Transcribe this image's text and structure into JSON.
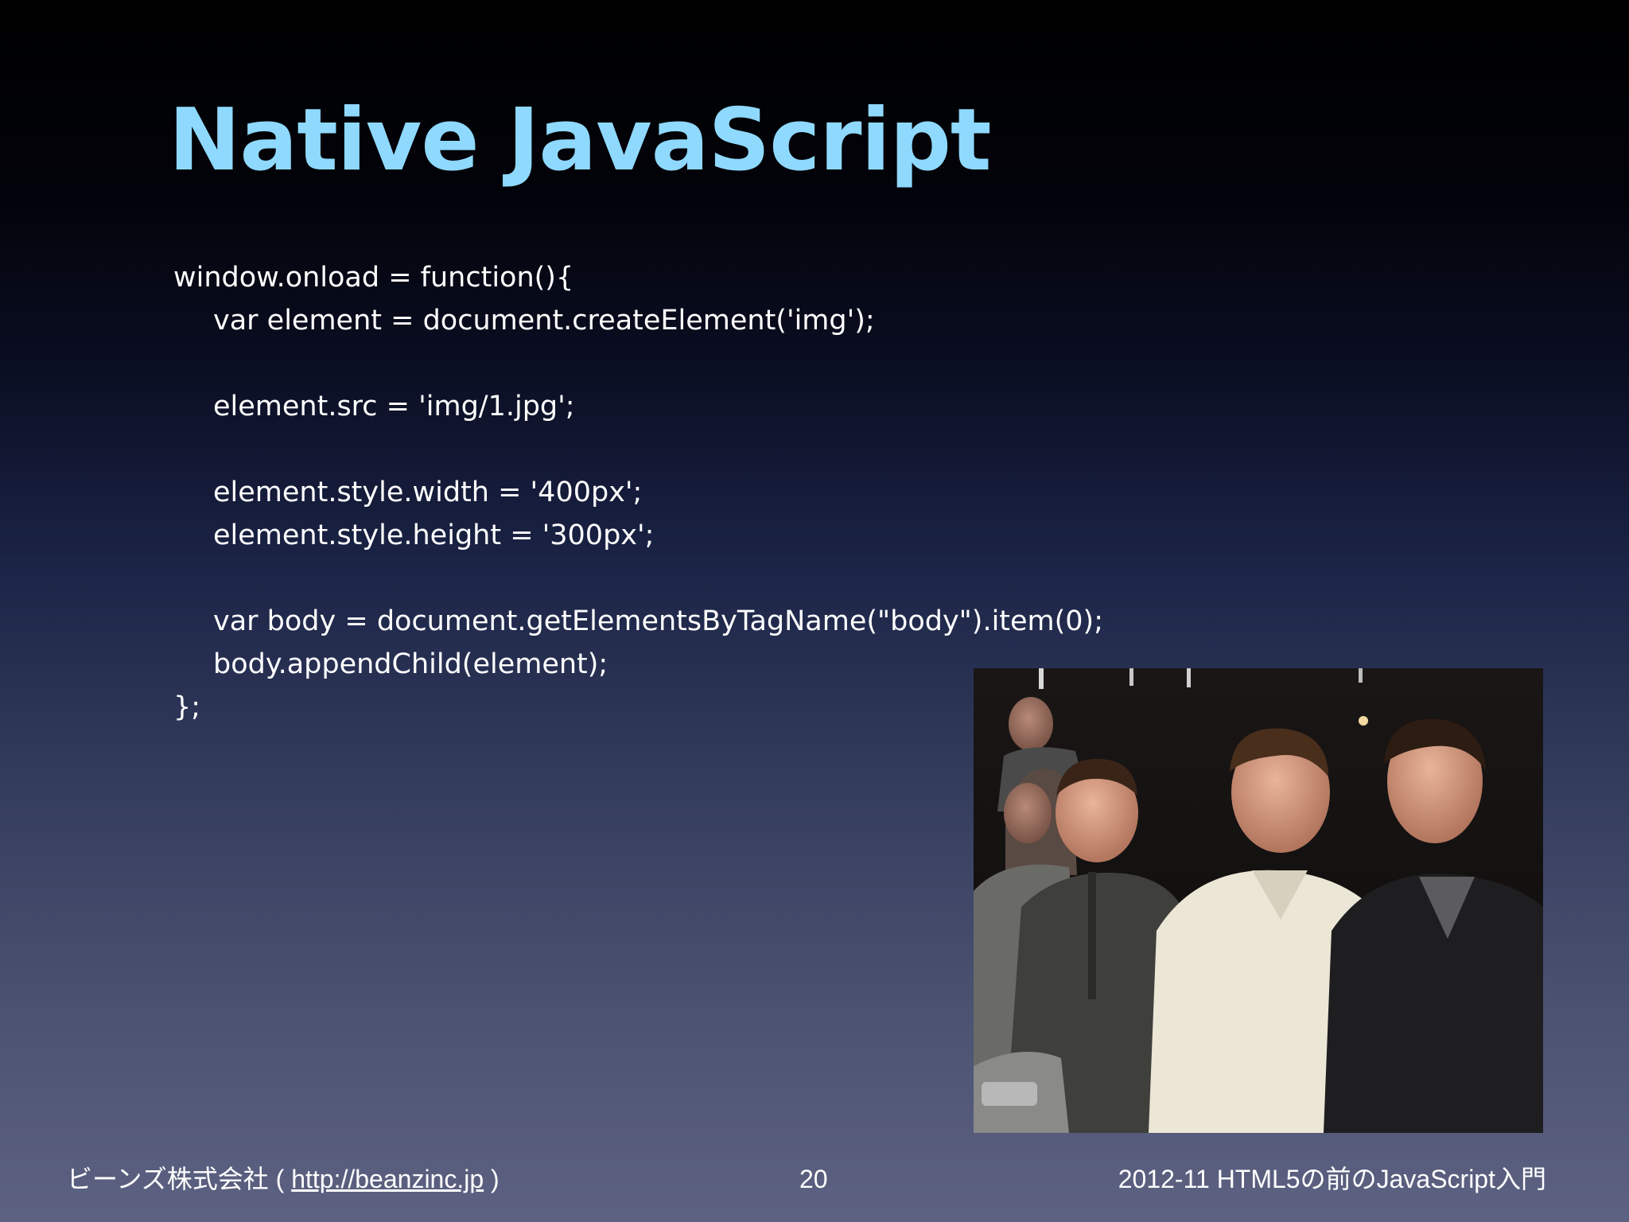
{
  "slide": {
    "title": "Native JavaScript",
    "code_lines": [
      "window.onload = function(){",
      "var element = document.createElement('img');",
      "",
      "element.src = 'img/1.jpg';",
      "",
      "element.style.width = '400px';",
      "element.style.height = '300px';",
      "",
      "var body = document.getElementsByTagName(\"body\").item(0);",
      "body.appendChild(element);",
      "};"
    ]
  },
  "footer": {
    "company": "ビーンズ株式会社 (",
    "link": "http://beanzinc.jp",
    "company_close": ")",
    "page_number": "20",
    "presentation": "2012-11 HTML5の前のJavaScript入門"
  },
  "colors": {
    "title": "#8fd9ff",
    "text": "#ffffff",
    "background_top": "#000000",
    "background_bottom": "#5d6282"
  }
}
